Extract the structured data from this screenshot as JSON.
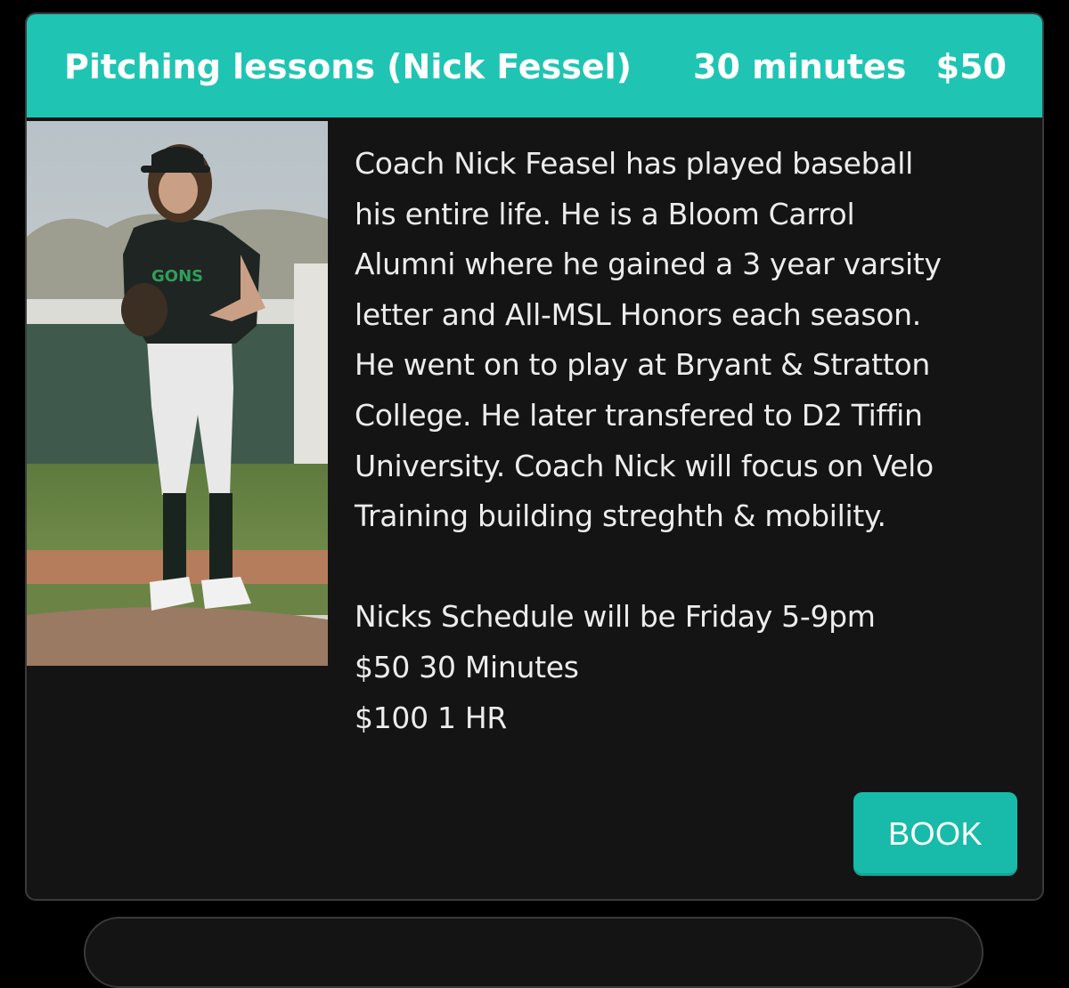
{
  "card": {
    "header": {
      "title": "Pitching lessons (Nick Fessel)",
      "duration": "30 minutes",
      "price": "$50",
      "background_color": "#20c4b3"
    },
    "photo": {
      "jersey_text": "GONS"
    },
    "description": {
      "lines": [
        "Coach Nick Feasel has played baseball",
        "his entire life. He is a Bloom Carrol",
        "Alumni where he gained a 3 year varsity",
        "letter and All-MSL Honors each season.",
        "He went on to play at Bryant & Stratton",
        "College. He later transfered to D2 Tiffin",
        "University. Coach Nick will focus on Velo",
        "Training building streghth & mobility."
      ],
      "schedule": "Nicks Schedule will be Friday 5-9pm",
      "rate_30": "$50 30 Minutes",
      "rate_60": "$100 1 HR"
    },
    "book_button": {
      "label": "BOOK",
      "color": "#18bba9"
    }
  }
}
